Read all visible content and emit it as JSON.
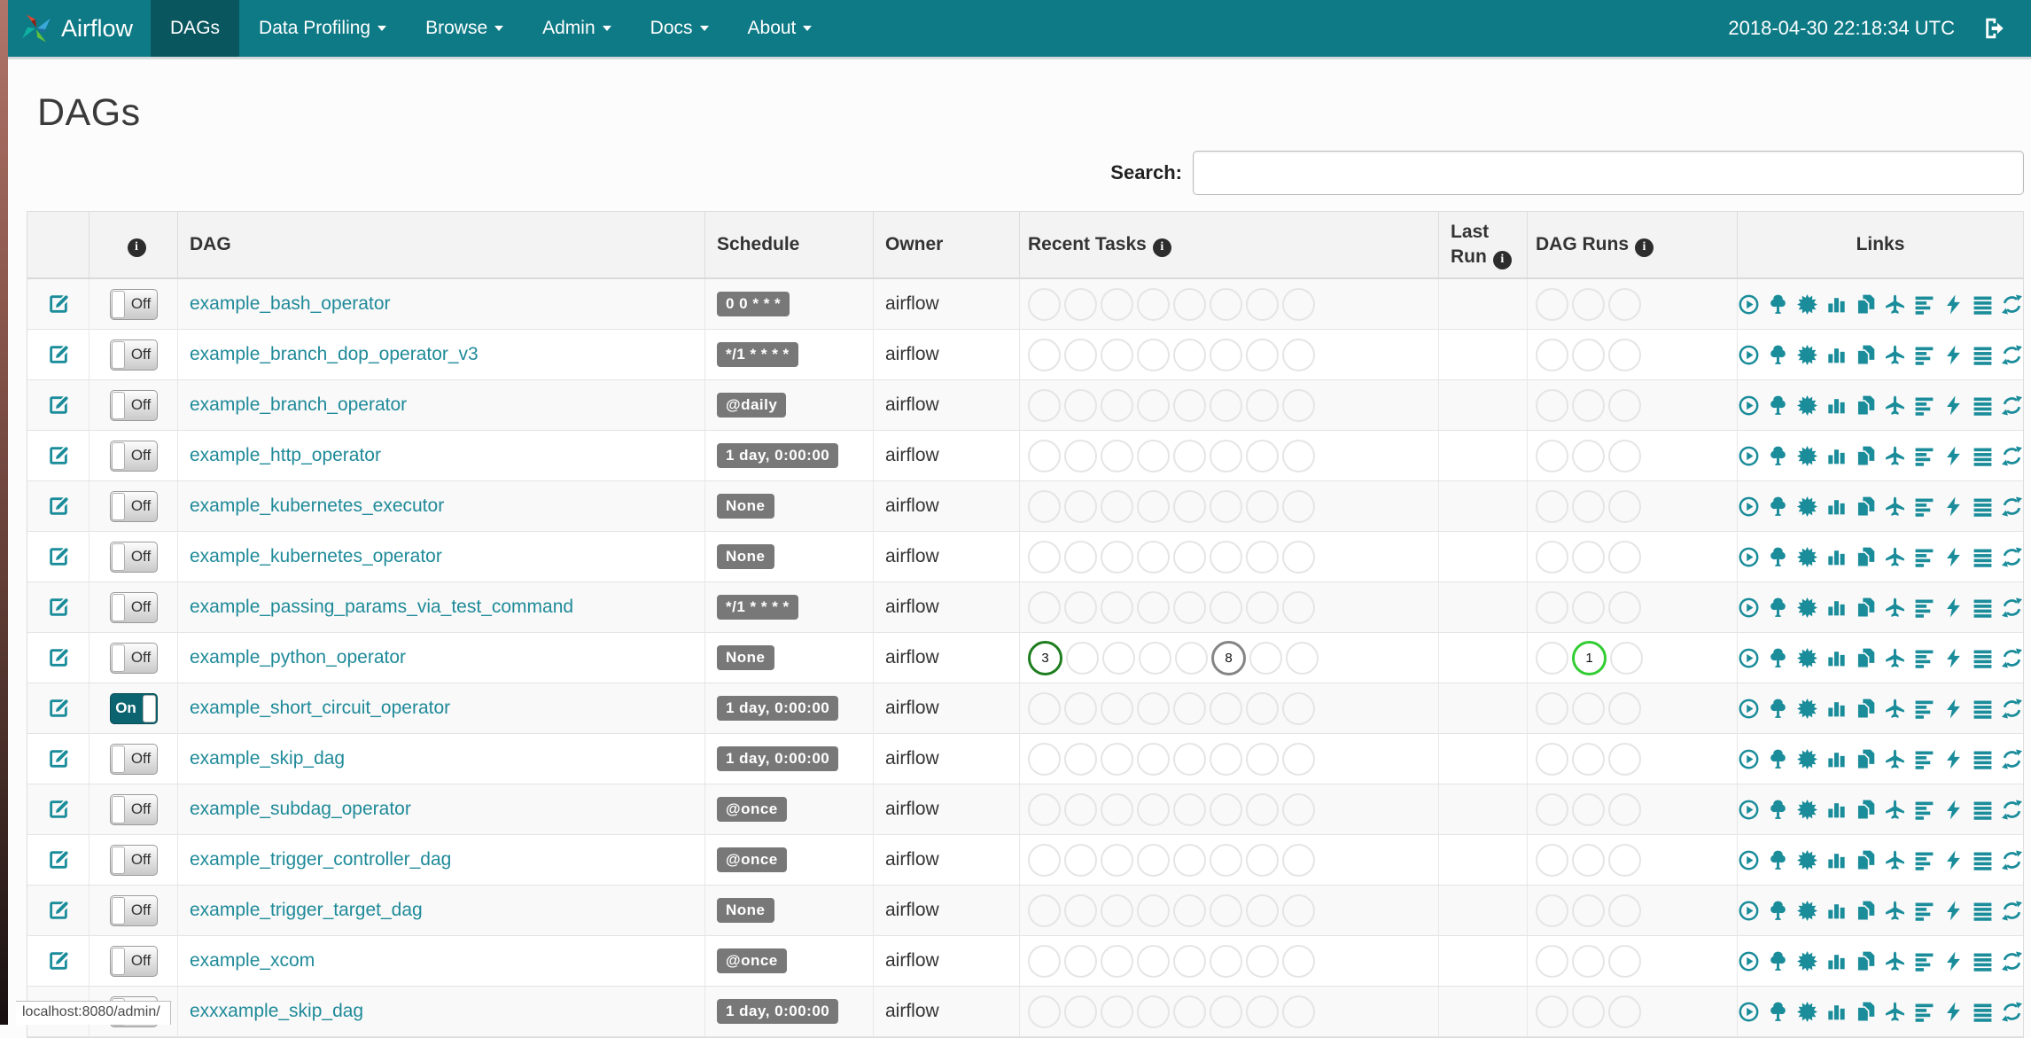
{
  "colors": {
    "navbar": "#0d7a86",
    "navbar_active": "#09565f",
    "link_teal": "#1f8a99",
    "icon_teal": "#1a8c9a",
    "badge_gray": "#787878",
    "states": {
      "success": "#1e7d1e",
      "queued": "#858585",
      "running": "#32cd32"
    }
  },
  "navbar": {
    "brand": "Airflow",
    "items": [
      {
        "label": "DAGs",
        "active": true,
        "caret": false
      },
      {
        "label": "Data Profiling",
        "active": false,
        "caret": true
      },
      {
        "label": "Browse",
        "active": false,
        "caret": true
      },
      {
        "label": "Admin",
        "active": false,
        "caret": true
      },
      {
        "label": "Docs",
        "active": false,
        "caret": true
      },
      {
        "label": "About",
        "active": false,
        "caret": true
      }
    ],
    "clock": "2018-04-30 22:18:34 UTC"
  },
  "page": {
    "title": "DAGs"
  },
  "search": {
    "label": "Search:",
    "value": ""
  },
  "table": {
    "headers": [
      {
        "label": "",
        "info": false
      },
      {
        "label": "",
        "info": true
      },
      {
        "label": "DAG",
        "info": false
      },
      {
        "label": "Schedule",
        "info": false
      },
      {
        "label": "Owner",
        "info": false
      },
      {
        "label": "Recent Tasks",
        "info": true
      },
      {
        "label": "Last Run",
        "info": true
      },
      {
        "label": "DAG Runs",
        "info": true
      },
      {
        "label": "Links",
        "info": false
      }
    ],
    "recent_task_slots": 8,
    "dag_run_slots": 3,
    "links": [
      "trigger-dag",
      "tree-view",
      "graph-view",
      "task-duration",
      "task-tries",
      "landing-times",
      "gantt-view",
      "code-view",
      "logs",
      "refresh"
    ],
    "rows": [
      {
        "dag": "example_bash_operator",
        "toggle": "Off",
        "schedule": "0 0 * * *",
        "owner": "airflow",
        "last_run": "",
        "recent_tasks": [],
        "dag_runs": []
      },
      {
        "dag": "example_branch_dop_operator_v3",
        "toggle": "Off",
        "schedule": "*/1 * * * *",
        "owner": "airflow",
        "last_run": "",
        "recent_tasks": [],
        "dag_runs": []
      },
      {
        "dag": "example_branch_operator",
        "toggle": "Off",
        "schedule": "@daily",
        "owner": "airflow",
        "last_run": "",
        "recent_tasks": [],
        "dag_runs": []
      },
      {
        "dag": "example_http_operator",
        "toggle": "Off",
        "schedule": "1 day, 0:00:00",
        "owner": "airflow",
        "last_run": "",
        "recent_tasks": [],
        "dag_runs": []
      },
      {
        "dag": "example_kubernetes_executor",
        "toggle": "Off",
        "schedule": "None",
        "owner": "airflow",
        "last_run": "",
        "recent_tasks": [],
        "dag_runs": []
      },
      {
        "dag": "example_kubernetes_operator",
        "toggle": "Off",
        "schedule": "None",
        "owner": "airflow",
        "last_run": "",
        "recent_tasks": [],
        "dag_runs": []
      },
      {
        "dag": "example_passing_params_via_test_command",
        "toggle": "Off",
        "schedule": "*/1 * * * *",
        "owner": "airflow",
        "last_run": "",
        "recent_tasks": [],
        "dag_runs": []
      },
      {
        "dag": "example_python_operator",
        "toggle": "Off",
        "schedule": "None",
        "owner": "airflow",
        "last_run": "",
        "recent_tasks": [
          {
            "slot": 1,
            "count": "3",
            "state": "success"
          },
          {
            "slot": 6,
            "count": "8",
            "state": "queued"
          }
        ],
        "dag_runs": [
          {
            "slot": 2,
            "count": "1",
            "state": "running"
          }
        ]
      },
      {
        "dag": "example_short_circuit_operator",
        "toggle": "On",
        "schedule": "1 day, 0:00:00",
        "owner": "airflow",
        "last_run": "",
        "recent_tasks": [],
        "dag_runs": []
      },
      {
        "dag": "example_skip_dag",
        "toggle": "Off",
        "schedule": "1 day, 0:00:00",
        "owner": "airflow",
        "last_run": "",
        "recent_tasks": [],
        "dag_runs": []
      },
      {
        "dag": "example_subdag_operator",
        "toggle": "Off",
        "schedule": "@once",
        "owner": "airflow",
        "last_run": "",
        "recent_tasks": [],
        "dag_runs": []
      },
      {
        "dag": "example_trigger_controller_dag",
        "toggle": "Off",
        "schedule": "@once",
        "owner": "airflow",
        "last_run": "",
        "recent_tasks": [],
        "dag_runs": []
      },
      {
        "dag": "example_trigger_target_dag",
        "toggle": "Off",
        "schedule": "None",
        "owner": "airflow",
        "last_run": "",
        "recent_tasks": [],
        "dag_runs": []
      },
      {
        "dag": "example_xcom",
        "toggle": "Off",
        "schedule": "@once",
        "owner": "airflow",
        "last_run": "",
        "recent_tasks": [],
        "dag_runs": []
      },
      {
        "dag": "exxxample_skip_dag",
        "toggle": "Off",
        "schedule": "1 day, 0:00:00",
        "owner": "airflow",
        "last_run": "",
        "recent_tasks": [],
        "dag_runs": []
      }
    ]
  },
  "statusbar": {
    "text": "localhost:8080/admin/"
  }
}
